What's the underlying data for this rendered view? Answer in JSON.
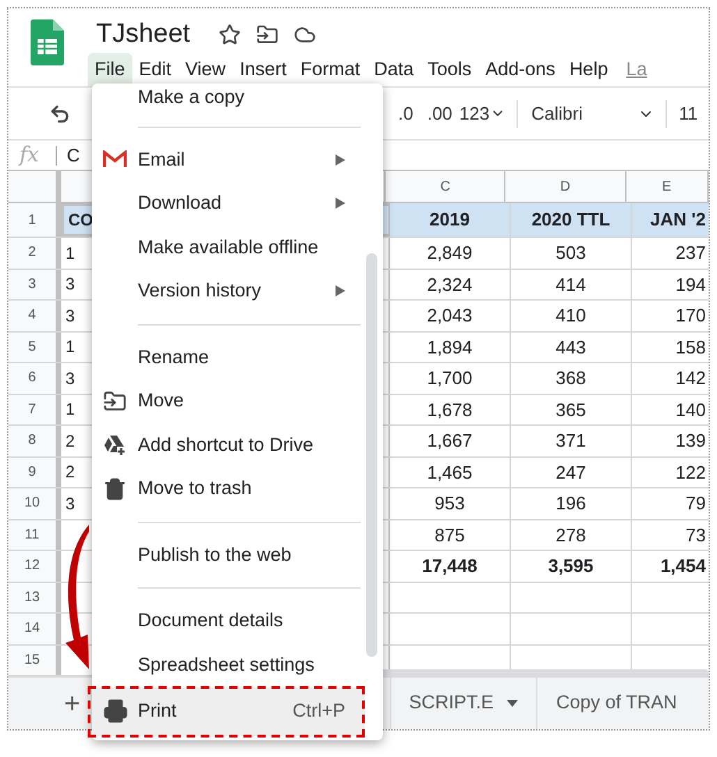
{
  "app": {
    "title": "TJsheet",
    "menubar": [
      {
        "label": "File",
        "selected": true
      },
      {
        "label": "Edit",
        "selected": false
      },
      {
        "label": "View",
        "selected": false
      },
      {
        "label": "Insert",
        "selected": false
      },
      {
        "label": "Format",
        "selected": false
      },
      {
        "label": "Data",
        "selected": false
      },
      {
        "label": "Tools",
        "selected": false
      },
      {
        "label": "Add-ons",
        "selected": false
      },
      {
        "label": "Help",
        "selected": false
      }
    ],
    "last_edit": "La"
  },
  "toolbar": {
    "decimal_decrease": ".0",
    "decimal_increase": ".00",
    "number_format": "123",
    "font": "Calibri",
    "font_size": "11"
  },
  "formula_bar": {
    "label": "fx",
    "value": "C"
  },
  "sheet": {
    "columns": [
      "C",
      "D",
      "E"
    ],
    "rows": [
      {
        "number": "1",
        "kind": "header",
        "column_a": "CO",
        "values": [
          "2019",
          "2020 TTL",
          "JAN '2"
        ]
      },
      {
        "number": "2",
        "kind": "data",
        "column_a": "1",
        "values": [
          "2,849",
          "503",
          "237"
        ]
      },
      {
        "number": "3",
        "kind": "data",
        "column_a": "3",
        "values": [
          "2,324",
          "414",
          "194"
        ]
      },
      {
        "number": "4",
        "kind": "data",
        "column_a": "3",
        "values": [
          "2,043",
          "410",
          "170"
        ]
      },
      {
        "number": "5",
        "kind": "data",
        "column_a": "1",
        "values": [
          "1,894",
          "443",
          "158"
        ]
      },
      {
        "number": "6",
        "kind": "data",
        "column_a": "3",
        "values": [
          "1,700",
          "368",
          "142"
        ]
      },
      {
        "number": "7",
        "kind": "data",
        "column_a": "1",
        "values": [
          "1,678",
          "365",
          "140"
        ]
      },
      {
        "number": "8",
        "kind": "data",
        "column_a": "2",
        "values": [
          "1,667",
          "371",
          "139"
        ]
      },
      {
        "number": "9",
        "kind": "data",
        "column_a": "2",
        "values": [
          "1,465",
          "247",
          "122"
        ]
      },
      {
        "number": "10",
        "kind": "data",
        "column_a": "3",
        "values": [
          "953",
          "196",
          "79"
        ]
      },
      {
        "number": "11",
        "kind": "data",
        "values": [
          "875",
          "278",
          "73"
        ]
      },
      {
        "number": "12",
        "kind": "total",
        "values": [
          "17,448",
          "3,595",
          "1,454"
        ]
      },
      {
        "number": "13",
        "kind": "empty"
      },
      {
        "number": "14",
        "kind": "empty"
      },
      {
        "number": "15",
        "kind": "empty"
      }
    ]
  },
  "file_menu": {
    "items": [
      {
        "kind": "item",
        "label": "Make a copy",
        "submenu": false,
        "selected": false
      },
      {
        "kind": "divider"
      },
      {
        "kind": "item",
        "label": "Email",
        "submenu": true,
        "selected": false
      },
      {
        "kind": "item",
        "label": "Download",
        "submenu": true,
        "selected": false
      },
      {
        "kind": "item",
        "label": "Make available offline",
        "submenu": false,
        "selected": false
      },
      {
        "kind": "item",
        "label": "Version history",
        "submenu": true,
        "selected": false
      },
      {
        "kind": "divider"
      },
      {
        "kind": "item",
        "label": "Rename",
        "submenu": false,
        "selected": false
      },
      {
        "kind": "item",
        "label": "Move",
        "submenu": false,
        "selected": false
      },
      {
        "kind": "item",
        "label": "Add shortcut to Drive",
        "submenu": false,
        "selected": false
      },
      {
        "kind": "item",
        "label": "Move to trash",
        "submenu": false,
        "selected": false
      },
      {
        "kind": "divider"
      },
      {
        "kind": "item",
        "label": "Publish to the web",
        "submenu": false,
        "selected": false
      },
      {
        "kind": "divider"
      },
      {
        "kind": "item",
        "label": "Document details",
        "submenu": false,
        "selected": false
      },
      {
        "kind": "item",
        "label": "Spreadsheet settings",
        "submenu": false,
        "selected": false
      },
      {
        "kind": "item",
        "label": "Print",
        "shortcut": "Ctrl+P",
        "submenu": false,
        "selected": true
      }
    ]
  },
  "sheet_bar": {
    "add": "+",
    "tabs": [
      {
        "label": "SCRIPT.E",
        "dropdown": true
      },
      {
        "label": "Copy of TRAN",
        "dropdown": false
      }
    ]
  }
}
